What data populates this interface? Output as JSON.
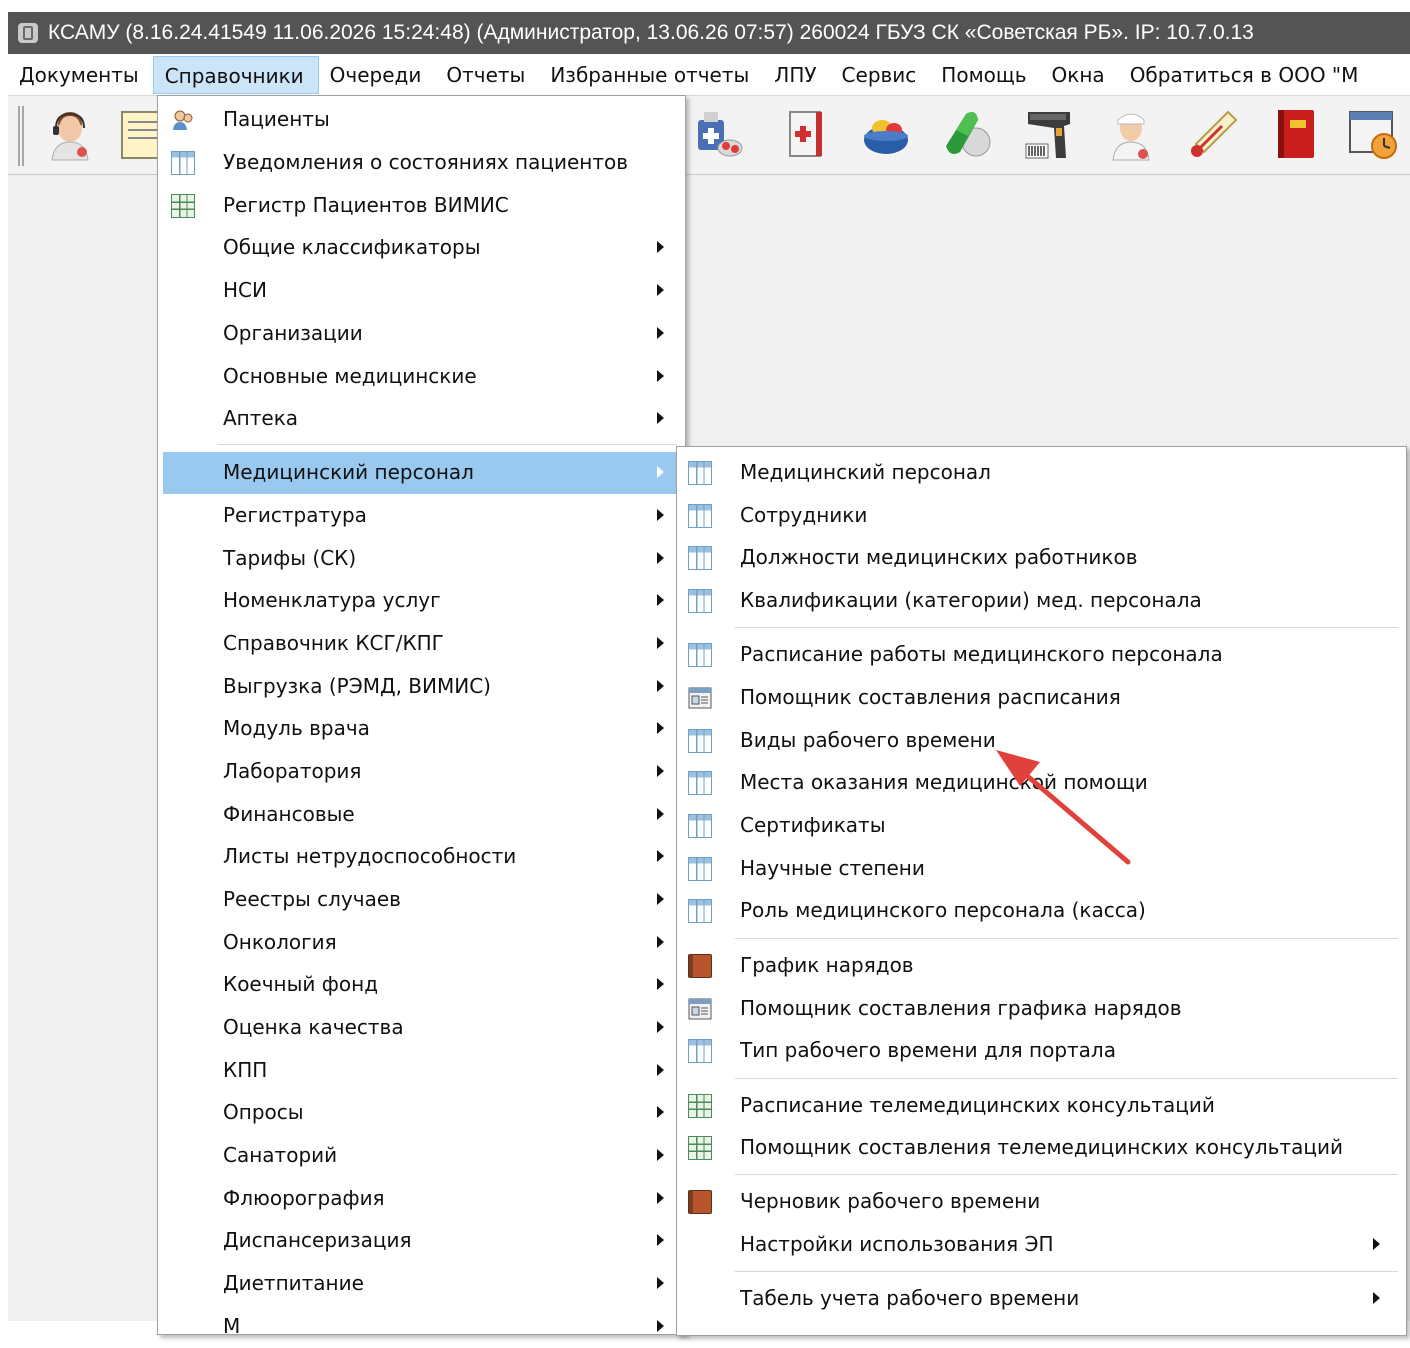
{
  "window": {
    "title": "КСАМУ (8.16.24.41549 11.06.2026 15:24:48) (Администратор, 13.06.26 07:57)  260024 ГБУЗ СК «Советская РБ». IP: 10.7.0.13"
  },
  "menubar": {
    "items": [
      {
        "label": "Документы"
      },
      {
        "label": "Справочники"
      },
      {
        "label": "Очереди"
      },
      {
        "label": "Отчеты"
      },
      {
        "label": "Избранные отчеты"
      },
      {
        "label": "ЛПУ"
      },
      {
        "label": "Сервис"
      },
      {
        "label": "Помощь"
      },
      {
        "label": "Окна"
      },
      {
        "label": "Обратиться в ООО \"М"
      }
    ]
  },
  "toolbar": {
    "icons": [
      "operator-headset-icon",
      "notebook-icon",
      "medicine-kit-icon",
      "first-aid-book-icon",
      "pills-basket-icon",
      "capsule-icon",
      "barcode-scanner-icon",
      "nurse-icon",
      "thermometer-icon",
      "red-book-icon",
      "schedule-clock-icon"
    ]
  },
  "menu": {
    "items": [
      {
        "label": "Пациенты",
        "icon": "patients-icon"
      },
      {
        "label": "Уведомления о состояниях пациентов",
        "icon": "table-icon"
      },
      {
        "label": "Регистр Пациентов ВИМИС",
        "icon": "green-table-icon"
      },
      {
        "label": "Общие классификаторы"
      },
      {
        "label": "НСИ"
      },
      {
        "label": "Организации"
      },
      {
        "label": "Основные медицинские"
      },
      {
        "label": "Аптека"
      },
      {
        "label": "Медицинский персонал"
      },
      {
        "label": "Регистратура"
      },
      {
        "label": "Тарифы (СК)"
      },
      {
        "label": "Номенклатура услуг"
      },
      {
        "label": "Справочник КСГ/КПГ"
      },
      {
        "label": "Выгрузка (РЭМД, ВИМИС)"
      },
      {
        "label": "Модуль врача"
      },
      {
        "label": "Лаборатория"
      },
      {
        "label": "Финансовые"
      },
      {
        "label": "Листы нетрудоспособности"
      },
      {
        "label": "Реестры случаев"
      },
      {
        "label": "Онкология"
      },
      {
        "label": "Коечный фонд"
      },
      {
        "label": "Оценка качества"
      },
      {
        "label": "КПП"
      },
      {
        "label": "Опросы"
      },
      {
        "label": "Санаторий"
      },
      {
        "label": "Флюорография"
      },
      {
        "label": "Диспансеризация"
      },
      {
        "label": "Диетпитание"
      },
      {
        "label": "М"
      }
    ]
  },
  "submenu": {
    "items": [
      {
        "label": "Медицинский персонал",
        "icon": "table-icon"
      },
      {
        "label": "Сотрудники",
        "icon": "table-icon"
      },
      {
        "label": "Должности медицинских работников",
        "icon": "table-icon"
      },
      {
        "label": "Квалификации (категории) мед. персонала",
        "icon": "table-icon"
      },
      {
        "label": "Расписание работы медицинского персонала",
        "icon": "table-icon"
      },
      {
        "label": "Помощник составления расписания",
        "icon": "wizard-card-icon"
      },
      {
        "label": "Виды рабочего времени",
        "icon": "table-icon"
      },
      {
        "label": "Места оказания медицинской помощи",
        "icon": "table-icon"
      },
      {
        "label": "Сертификаты",
        "icon": "table-icon"
      },
      {
        "label": "Научные степени",
        "icon": "table-icon"
      },
      {
        "label": "Роль медицинского персонала (касса)",
        "icon": "table-icon"
      },
      {
        "label": "График нарядов",
        "icon": "book-icon"
      },
      {
        "label": "Помощник составления графика нарядов",
        "icon": "wizard-card-icon"
      },
      {
        "label": "Тип рабочего времени для портала",
        "icon": "table-icon"
      },
      {
        "label": "Расписание телемедицинских консультаций",
        "icon": "green-table-icon"
      },
      {
        "label": "Помощник составления телемедицинских консультаций",
        "icon": "green-table-icon"
      },
      {
        "label": "Черновик рабочего времени",
        "icon": "book-icon"
      },
      {
        "label": "Настройки использования ЭП"
      },
      {
        "label": "Табель учета рабочего времени"
      }
    ]
  },
  "annotation": {
    "color": "#e0413a"
  }
}
